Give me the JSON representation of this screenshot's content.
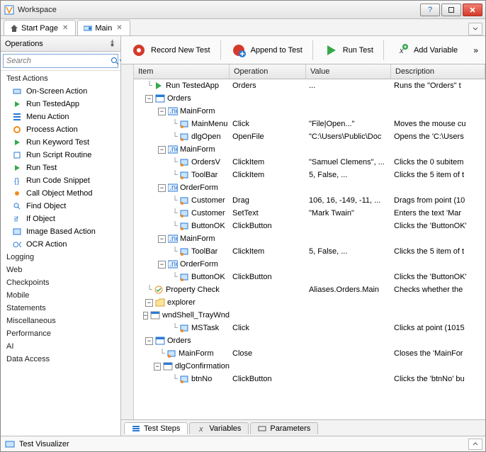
{
  "window": {
    "title": "Workspace"
  },
  "tabs": [
    {
      "label": "Start Page"
    },
    {
      "label": "Main"
    }
  ],
  "sidebar": {
    "title": "Operations",
    "search_placeholder": "Search",
    "categories": {
      "test_actions": "Test Actions",
      "logging": "Logging",
      "web": "Web",
      "checkpoints": "Checkpoints",
      "mobile": "Mobile",
      "statements": "Statements",
      "miscellaneous": "Miscellaneous",
      "performance": "Performance",
      "ai": "AI",
      "data_access": "Data Access"
    },
    "ops": [
      "On-Screen Action",
      "Run TestedApp",
      "Menu Action",
      "Process Action",
      "Run Keyword Test",
      "Run Script Routine",
      "Run Test",
      "Run Code Snippet",
      "Call Object Method",
      "Find Object",
      "If Object",
      "Image Based Action",
      "OCR Action"
    ]
  },
  "toolbar": {
    "record": "Record New Test",
    "append": "Append to Test",
    "run": "Run Test",
    "addvar": "Add Variable"
  },
  "grid": {
    "headers": {
      "item": "Item",
      "operation": "Operation",
      "value": "Value",
      "description": "Description"
    }
  },
  "rows": [
    {
      "d": 0,
      "t": "",
      "icon": "run",
      "item": "Run TestedApp",
      "op": "Orders",
      "val": "...",
      "desc": "Runs the \"Orders\" t"
    },
    {
      "d": 0,
      "t": "-",
      "icon": "app",
      "item": "Orders",
      "op": "",
      "val": "",
      "desc": ""
    },
    {
      "d": 1,
      "t": "-",
      "icon": "net",
      "item": "MainForm",
      "op": "",
      "val": "",
      "desc": ""
    },
    {
      "d": 2,
      "t": "",
      "icon": "obj",
      "item": "MainMenu",
      "op": "Click",
      "val": "\"File|Open...\"",
      "desc": "Moves the mouse cu"
    },
    {
      "d": 2,
      "t": "",
      "icon": "obj",
      "item": "dlgOpen",
      "op": "OpenFile",
      "val": "\"C:\\Users\\Public\\Doc",
      "desc": "Opens the 'C:\\Users"
    },
    {
      "d": 1,
      "t": "-",
      "icon": "net",
      "item": "MainForm",
      "op": "",
      "val": "",
      "desc": ""
    },
    {
      "d": 2,
      "t": "",
      "icon": "obj",
      "item": "OrdersV",
      "op": "ClickItem",
      "val": "\"Samuel Clemens\", ...",
      "desc": "Clicks the 0 subitem"
    },
    {
      "d": 2,
      "t": "",
      "icon": "obj",
      "item": "ToolBar",
      "op": "ClickItem",
      "val": "5, False, ...",
      "desc": "Clicks the 5 item of t"
    },
    {
      "d": 1,
      "t": "-",
      "icon": "net",
      "item": "OrderForm",
      "op": "",
      "val": "",
      "desc": ""
    },
    {
      "d": 2,
      "t": "",
      "icon": "obj",
      "item": "Customer",
      "op": "Drag",
      "val": "106, 16, -149, -11, ...",
      "desc": "Drags from point (10"
    },
    {
      "d": 2,
      "t": "",
      "icon": "obj",
      "item": "Customer",
      "op": "SetText",
      "val": "\"Mark Twain\"",
      "desc": "Enters the text 'Mar"
    },
    {
      "d": 2,
      "t": "",
      "icon": "obj",
      "item": "ButtonOK",
      "op": "ClickButton",
      "val": "",
      "desc": "Clicks the 'ButtonOK'"
    },
    {
      "d": 1,
      "t": "-",
      "icon": "net",
      "item": "MainForm",
      "op": "",
      "val": "",
      "desc": ""
    },
    {
      "d": 2,
      "t": "",
      "icon": "obj",
      "item": "ToolBar",
      "op": "ClickItem",
      "val": "5, False, ...",
      "desc": "Clicks the 5 item of t"
    },
    {
      "d": 1,
      "t": "-",
      "icon": "net",
      "item": "OrderForm",
      "op": "",
      "val": "",
      "desc": ""
    },
    {
      "d": 2,
      "t": "",
      "icon": "obj",
      "item": "ButtonOK",
      "op": "ClickButton",
      "val": "",
      "desc": "Clicks the 'ButtonOK'"
    },
    {
      "d": 0,
      "t": "",
      "icon": "check",
      "item": "Property Check",
      "op": "",
      "val": "Aliases.Orders.Main",
      "desc": "Checks whether the"
    },
    {
      "d": 0,
      "t": "-",
      "icon": "folder",
      "item": "explorer",
      "op": "",
      "val": "",
      "desc": ""
    },
    {
      "d": 1,
      "t": "-",
      "icon": "win",
      "item": "wndShell_TrayWnd",
      "op": "",
      "val": "",
      "desc": ""
    },
    {
      "d": 2,
      "t": "",
      "icon": "obj",
      "item": "MSTask",
      "op": "Click",
      "val": "",
      "desc": "Clicks at point (1015"
    },
    {
      "d": 0,
      "t": "-",
      "icon": "app",
      "item": "Orders",
      "op": "",
      "val": "",
      "desc": ""
    },
    {
      "d": 1,
      "t": "",
      "icon": "obj",
      "item": "MainForm",
      "op": "Close",
      "val": "",
      "desc": "Closes the 'MainFor"
    },
    {
      "d": 1,
      "t": "-",
      "icon": "win",
      "item": "dlgConfirmation",
      "op": "",
      "val": "",
      "desc": ""
    },
    {
      "d": 2,
      "t": "",
      "icon": "obj",
      "item": "btnNo",
      "op": "ClickButton",
      "val": "",
      "desc": "Clicks the 'btnNo' bu"
    }
  ],
  "bottom_tabs": {
    "steps": "Test Steps",
    "vars": "Variables",
    "params": "Parameters"
  },
  "visualizer": "Test Visualizer"
}
